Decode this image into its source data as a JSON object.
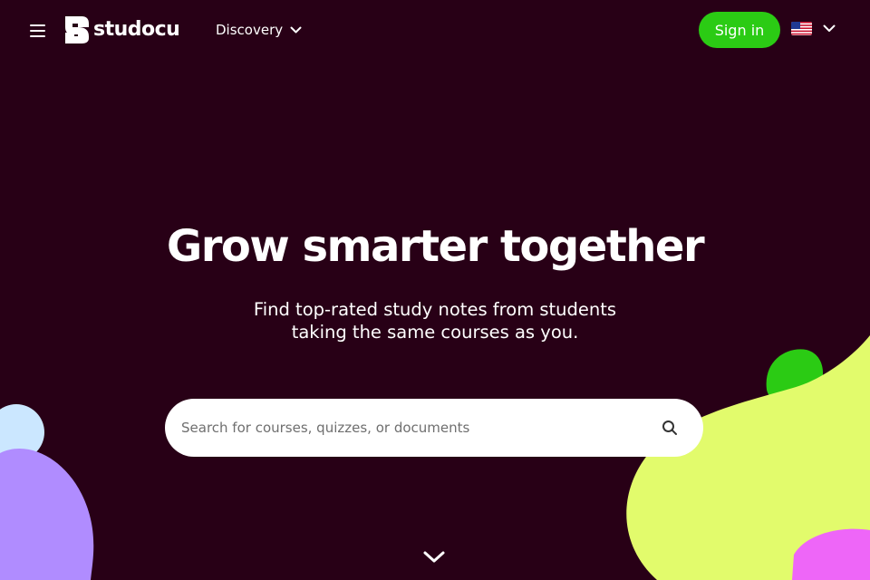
{
  "header": {
    "menu_icon": "hamburger-menu-icon",
    "brand": "studocu",
    "discovery_label": "Discovery",
    "signin_label": "Sign in",
    "language_flag": "us-flag-icon"
  },
  "hero": {
    "title": "Grow smarter together",
    "subtitle_line1": "Find top-rated study notes from students",
    "subtitle_line2": "taking the same courses as you."
  },
  "search": {
    "placeholder": "Search for courses, quizzes, or documents",
    "value": ""
  },
  "colors": {
    "background": "#280016",
    "accent_green": "#2bcb14",
    "blob_lime": "#e2fb6c",
    "blob_purple": "#b08cff",
    "blob_pink": "#ee66f8",
    "blob_light_blue": "#cbe7ff"
  }
}
